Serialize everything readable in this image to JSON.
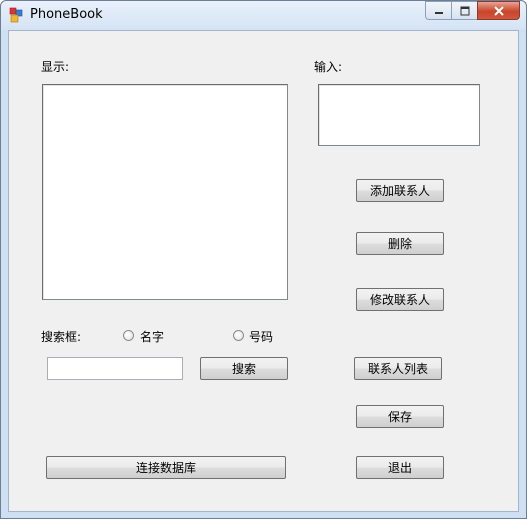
{
  "window": {
    "title": "PhoneBook"
  },
  "labels": {
    "display": "显示:",
    "input": "输入:",
    "search_box": "搜索框:"
  },
  "radios": {
    "name": "名字",
    "number": "号码"
  },
  "buttons": {
    "add_contact": "添加联系人",
    "delete": "删除",
    "modify_contact": "修改联系人",
    "contact_list": "联系人列表",
    "save": "保存",
    "exit": "退出",
    "search": "搜索",
    "connect_db": "连接数据库"
  },
  "fields": {
    "search_value": "",
    "input_value": "",
    "display_value": ""
  }
}
